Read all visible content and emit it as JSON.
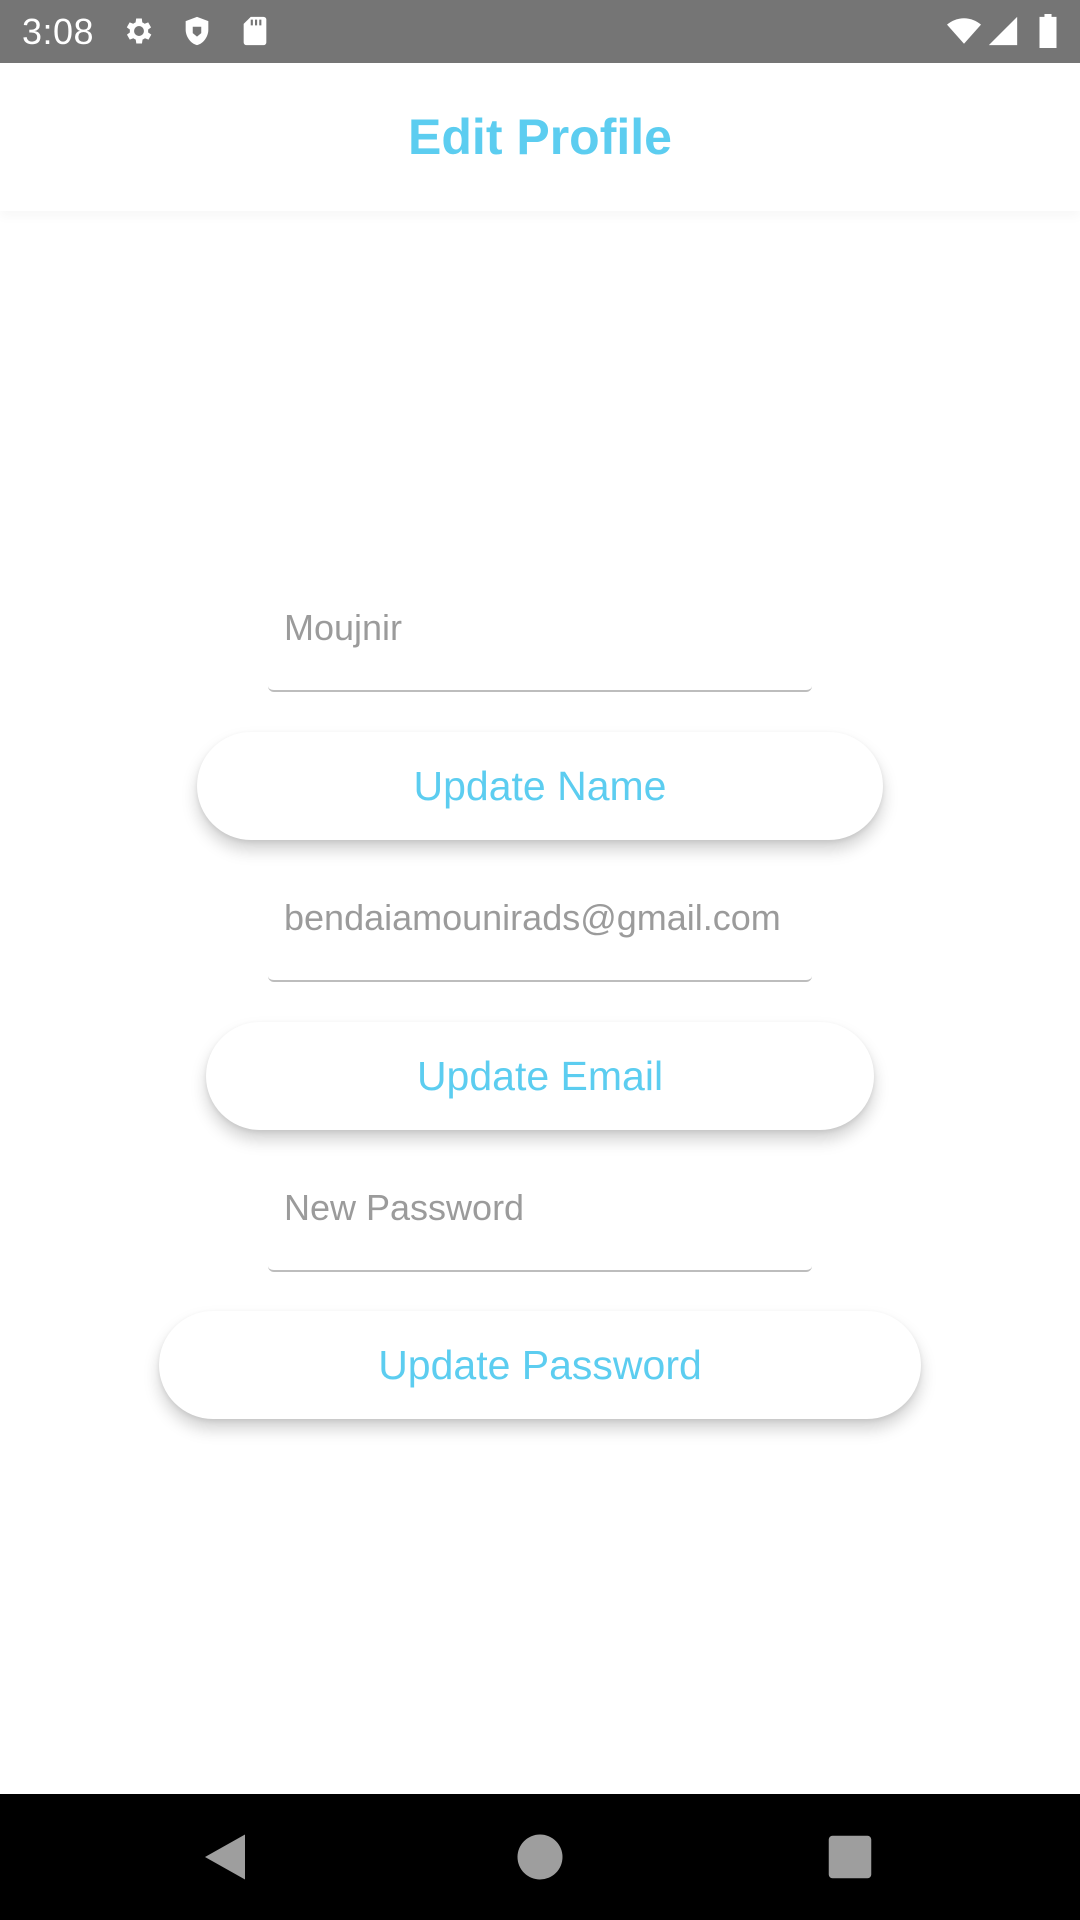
{
  "status_bar": {
    "time": "3:08",
    "icons": [
      "gear-icon",
      "shield-icon",
      "sd-card-icon",
      "wifi-icon",
      "cell-signal-icon",
      "battery-icon"
    ]
  },
  "app_bar": {
    "title": "Edit Profile"
  },
  "form": {
    "name_field": {
      "value": "Moujnir"
    },
    "update_name_label": "Update Name",
    "email_field": {
      "value": "bendaiamounirads@gmail.com"
    },
    "update_email_label": "Update Email",
    "password_field": {
      "placeholder": "New Password"
    },
    "update_password_label": "Update Password"
  },
  "nav_bar": {
    "icons": [
      "back-triangle-icon",
      "home-circle-icon",
      "recents-square-icon"
    ]
  },
  "colors": {
    "accent": "#5ccdf0",
    "status_bar": "#757575",
    "nav_bar": "#000000",
    "field_text": "#9b9b9b",
    "underline": "#bdbdbd"
  }
}
